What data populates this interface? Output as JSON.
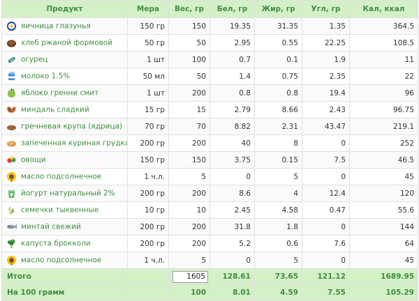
{
  "headers": {
    "product": "Продукт",
    "measure": "Мера",
    "weight": "Вес, гр",
    "protein": "Бел, гр",
    "fat": "Жир, гр",
    "carbs": "Угл, гр",
    "kcal": "Кал, ккал"
  },
  "rows": [
    {
      "icon": "fried-egg-icon",
      "name": "яичница глазунья",
      "measure": "150 гр",
      "weight": "150",
      "protein": "19.35",
      "fat": "31.35",
      "carbs": "1.35",
      "kcal": "364.5"
    },
    {
      "icon": "rye-bread-icon",
      "name": "хлеб ржаной формовой",
      "measure": "50 гр",
      "weight": "50",
      "protein": "2.95",
      "fat": "0.55",
      "carbs": "22.25",
      "kcal": "108.5"
    },
    {
      "icon": "cucumber-icon",
      "name": "огурец",
      "measure": "1 шт",
      "weight": "100",
      "protein": "0.7",
      "fat": "0.1",
      "carbs": "1.9",
      "kcal": "11"
    },
    {
      "icon": "milk-carton-icon",
      "name": "молоко 1.5%",
      "measure": "50 мл",
      "weight": "50",
      "protein": "1.4",
      "fat": "0.75",
      "carbs": "2.35",
      "kcal": "22"
    },
    {
      "icon": "green-apple-icon",
      "name": "яблоко гренни смит",
      "measure": "1 шт",
      "weight": "200",
      "protein": "0.8",
      "fat": "0.8",
      "carbs": "19.4",
      "kcal": "96"
    },
    {
      "icon": "almonds-icon",
      "name": "миндаль сладкий",
      "measure": "15 гр",
      "weight": "15",
      "protein": "2.79",
      "fat": "8.66",
      "carbs": "2.43",
      "kcal": "96.75"
    },
    {
      "icon": "buckwheat-icon",
      "name": "гречневая крупа (ядрица)",
      "measure": "70 гр",
      "weight": "70",
      "protein": "8.82",
      "fat": "2.31",
      "carbs": "43.47",
      "kcal": "219.1"
    },
    {
      "icon": "chicken-breast-icon",
      "name": "запеченная куриная грудка",
      "measure": "200 гр",
      "weight": "200",
      "protein": "40",
      "fat": "8",
      "carbs": "0",
      "kcal": "252"
    },
    {
      "icon": "vegetables-icon",
      "name": "овощи",
      "measure": "150 гр",
      "weight": "150",
      "protein": "3.75",
      "fat": "0.15",
      "carbs": "7.5",
      "kcal": "46.5"
    },
    {
      "icon": "sunflower-oil-icon",
      "name": "масло подсолнечное",
      "measure": "1 ч.л.",
      "weight": "5",
      "protein": "0",
      "fat": "5",
      "carbs": "0",
      "kcal": "45"
    },
    {
      "icon": "yogurt-glass-icon",
      "name": "йогурт натуральный 2%",
      "measure": "200 гр",
      "weight": "200",
      "protein": "8.6",
      "fat": "4",
      "carbs": "12.4",
      "kcal": "120"
    },
    {
      "icon": "pumpkin-seeds-icon",
      "name": "семечки тыквенные",
      "measure": "10 гр",
      "weight": "10",
      "protein": "2.45",
      "fat": "4.58",
      "carbs": "0.47",
      "kcal": "55.6"
    },
    {
      "icon": "pollock-fish-icon",
      "name": "минтай свежий",
      "measure": "200 гр",
      "weight": "200",
      "protein": "31.8",
      "fat": "1.8",
      "carbs": "0",
      "kcal": "144"
    },
    {
      "icon": "broccoli-icon",
      "name": "капуста брокколи",
      "measure": "200 гр",
      "weight": "200",
      "protein": "5.2",
      "fat": "0.6",
      "carbs": "7.6",
      "kcal": "64"
    },
    {
      "icon": "sunflower-oil-icon",
      "name": "масло подсолнечное",
      "measure": "1 ч.л.",
      "weight": "5",
      "protein": "0",
      "fat": "5",
      "carbs": "0",
      "kcal": "45"
    }
  ],
  "total": {
    "label": "Итого",
    "weight_value": "1605",
    "protein": "128.61",
    "fat": "73.65",
    "carbs": "121.12",
    "kcal": "1689.95"
  },
  "per100": {
    "label": "На 100 грамм",
    "weight": "100",
    "protein": "8.01",
    "fat": "4.59",
    "carbs": "7.55",
    "kcal": "105.29"
  }
}
